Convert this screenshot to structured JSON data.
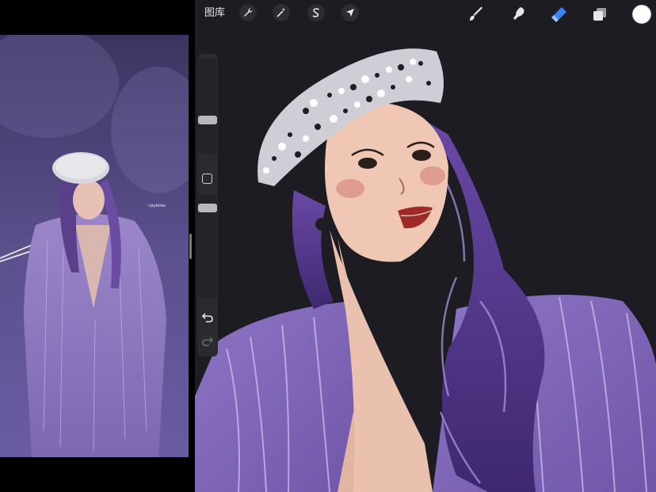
{
  "toolbar": {
    "gallery_label": "图库",
    "tools_left": [
      {
        "name": "actions",
        "icon": "wrench-icon"
      },
      {
        "name": "adjustments",
        "icon": "magic-wand-icon"
      },
      {
        "name": "selection",
        "icon": "selection-s-icon"
      },
      {
        "name": "transform",
        "icon": "arrow-cursor-icon"
      }
    ],
    "tools_right": [
      {
        "name": "brush",
        "icon": "brush-icon"
      },
      {
        "name": "smudge",
        "icon": "smudge-icon"
      },
      {
        "name": "eraser",
        "icon": "eraser-icon",
        "active": true
      },
      {
        "name": "layers",
        "icon": "layers-icon"
      }
    ],
    "current_color": "#ffffff",
    "active_tool_color": "#3b82f6"
  },
  "sidebar": {
    "brush_size_level": 0.35,
    "opacity_level": 0.15,
    "modify_icon": "square-icon",
    "undo_icon": "undo-icon",
    "redo_icon": "redo-icon"
  },
  "reference": {
    "watermark": "~Jaybilee"
  }
}
